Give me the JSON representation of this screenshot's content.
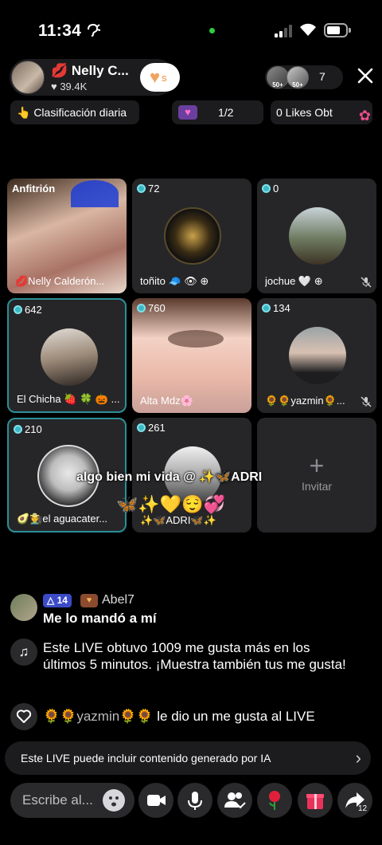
{
  "status_bar": {
    "time": "11:34",
    "time_icon": "✚",
    "battery_level": 0.6
  },
  "host": {
    "name": "💋 Nelly C...",
    "likes": "♥ 39.4K",
    "follow_badge": "S"
  },
  "viewers": {
    "badges": [
      "50+",
      "50+"
    ],
    "count": "7"
  },
  "toolbar": {
    "ranking": "👆 Clasificación diaria",
    "page": "1/2",
    "likes": "0 Likes  Obt"
  },
  "tiles": [
    {
      "label_top": "Anfitrión",
      "name": "💋Nelly Calderón..."
    },
    {
      "score": "72",
      "name": "toñito 🧢 👁 ⊕"
    },
    {
      "score": "0",
      "name": "jochue 🤍 ⊕"
    },
    {
      "score": "642",
      "name": "El Chicha 🍓 🍀 🎃 ..."
    },
    {
      "score": "760",
      "name": "Alta Mdz🌸"
    },
    {
      "score": "134",
      "name": "🌻🌻yazmin🌻..."
    },
    {
      "score": "210",
      "name": "🥑🧑‍🌾el aguacater..."
    },
    {
      "score": "261",
      "name": "✨🦋ADRI🦋✨"
    },
    {
      "invite_label": "Invitar"
    }
  ],
  "overlay": {
    "line1": "algo bien mi vida @ ✨🦋ADRI",
    "line2": "🦋✨💛😌💞"
  },
  "chat": {
    "comment": {
      "badge_level": "△ 14",
      "badge_heart": "♥",
      "user": "Abel7",
      "message": "Me lo mandó a mí"
    },
    "system_message": "Este LIVE obtuvo 1009 me gusta más en los últimos 5 minutos. ¡Muestra también tus me gusta!",
    "like_event": {
      "user": "🌻🌻yazmin🌻🌻",
      "text": " le dio un me gusta al LIVE"
    }
  },
  "ai_notice": "Este LIVE puede incluir contenido generado por IA",
  "bottom_bar": {
    "input_placeholder": "Escribe al...",
    "share_count": "12"
  },
  "colors": {
    "highlight_border": "#2b8f97",
    "score_dot": "#3cb7c4",
    "panel": "#1c1c1e",
    "tile": "#262628"
  }
}
